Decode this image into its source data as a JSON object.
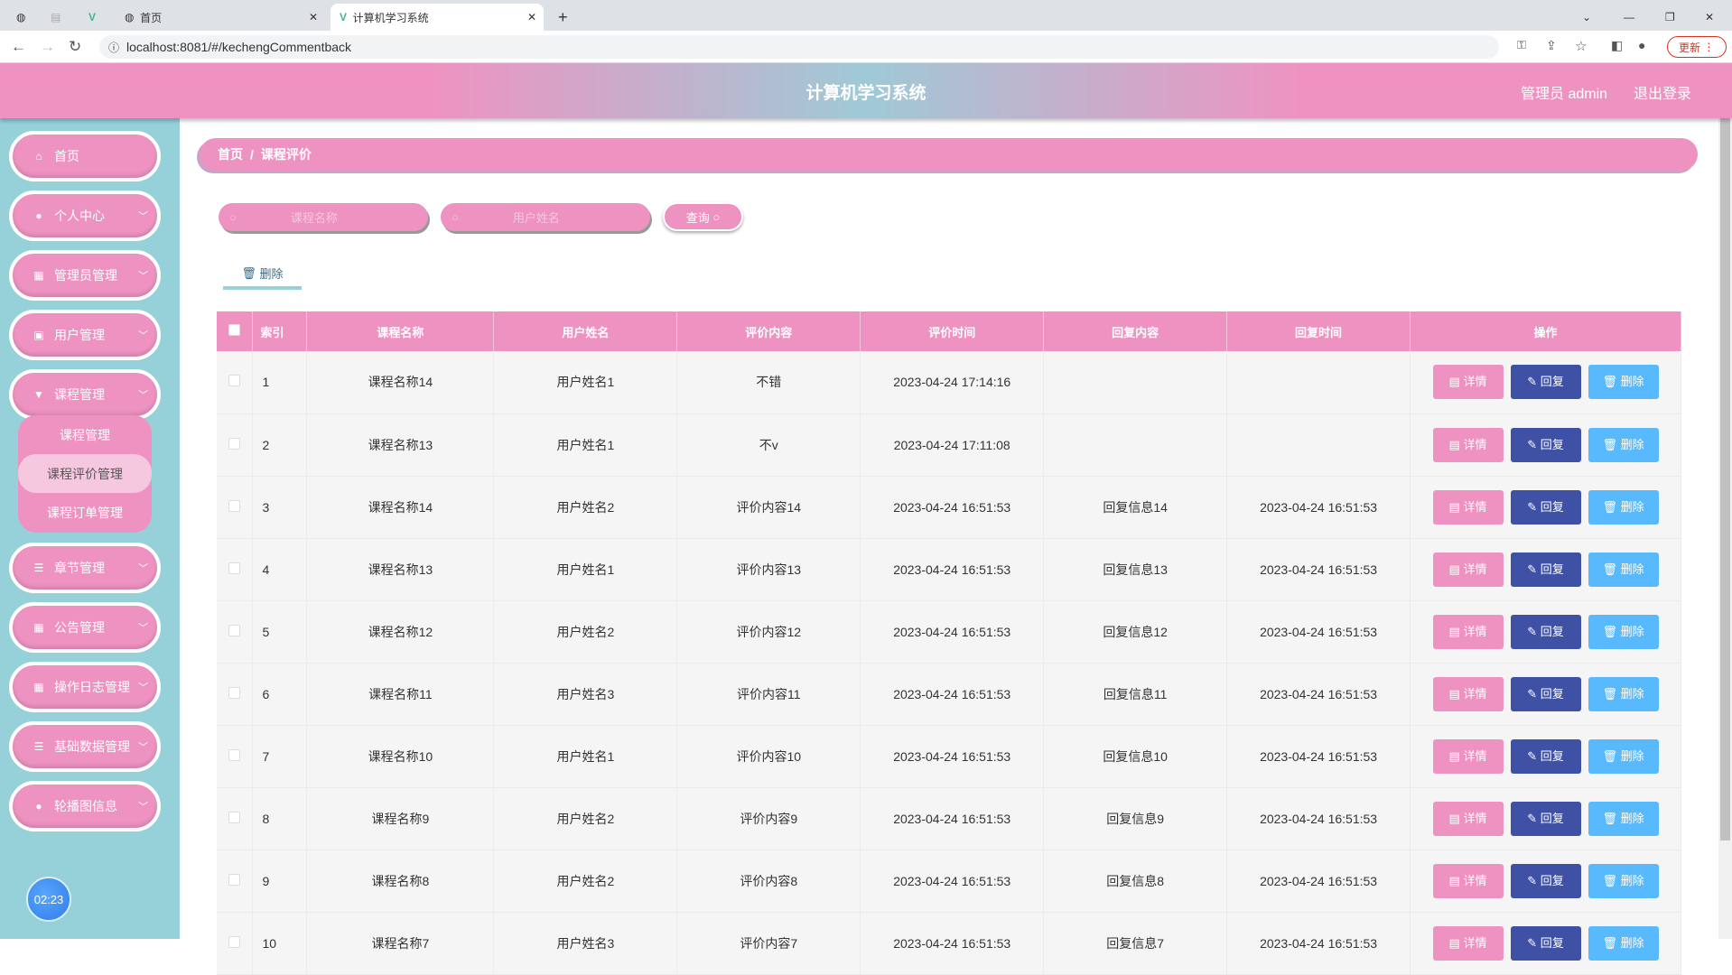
{
  "browser": {
    "tabs": [
      "首页",
      "计算机学习系统"
    ],
    "url": "localhost:8081/#/kechengCommentback",
    "update_label": "更新"
  },
  "header": {
    "title": "计算机学习系统",
    "user": "管理员 admin",
    "logout": "退出登录"
  },
  "sidebar": {
    "items": [
      {
        "label": "首页",
        "icon": "home-icon"
      },
      {
        "label": "个人中心",
        "icon": "user-icon"
      },
      {
        "label": "管理员管理",
        "icon": "grid-icon"
      },
      {
        "label": "用户管理",
        "icon": "clipboard-icon"
      },
      {
        "label": "课程管理",
        "icon": "brush-icon"
      },
      {
        "label": "章节管理",
        "icon": "list-icon"
      },
      {
        "label": "公告管理",
        "icon": "grid9-icon"
      },
      {
        "label": "操作日志管理",
        "icon": "grid-icon"
      },
      {
        "label": "基础数据管理",
        "icon": "list-icon"
      },
      {
        "label": "轮播图信息",
        "icon": "bulb-icon"
      }
    ],
    "submenu": [
      "课程管理",
      "课程评价管理",
      "课程订单管理"
    ],
    "clock": "02:23"
  },
  "breadcrumb": {
    "home": "首页",
    "sep": "/",
    "current": "课程评价"
  },
  "search": {
    "course_placeholder": "课程名称",
    "user_placeholder": "用户姓名",
    "query_label": "查询"
  },
  "toolbar": {
    "delete_label": "删除"
  },
  "table": {
    "headers": [
      "索引",
      "课程名称",
      "用户姓名",
      "评价内容",
      "评价时间",
      "回复内容",
      "回复时间",
      "操作"
    ],
    "actions": {
      "detail": "详情",
      "reply": "回复",
      "delete": "删除"
    },
    "rows": [
      [
        "1",
        "课程名称14",
        "用户姓名1",
        "不错",
        "2023-04-24 17:14:16",
        "",
        ""
      ],
      [
        "2",
        "课程名称13",
        "用户姓名1",
        "不v",
        "2023-04-24 17:11:08",
        "",
        ""
      ],
      [
        "3",
        "课程名称14",
        "用户姓名2",
        "评价内容14",
        "2023-04-24 16:51:53",
        "回复信息14",
        "2023-04-24 16:51:53"
      ],
      [
        "4",
        "课程名称13",
        "用户姓名1",
        "评价内容13",
        "2023-04-24 16:51:53",
        "回复信息13",
        "2023-04-24 16:51:53"
      ],
      [
        "5",
        "课程名称12",
        "用户姓名2",
        "评价内容12",
        "2023-04-24 16:51:53",
        "回复信息12",
        "2023-04-24 16:51:53"
      ],
      [
        "6",
        "课程名称11",
        "用户姓名3",
        "评价内容11",
        "2023-04-24 16:51:53",
        "回复信息11",
        "2023-04-24 16:51:53"
      ],
      [
        "7",
        "课程名称10",
        "用户姓名1",
        "评价内容10",
        "2023-04-24 16:51:53",
        "回复信息10",
        "2023-04-24 16:51:53"
      ],
      [
        "8",
        "课程名称9",
        "用户姓名2",
        "评价内容9",
        "2023-04-24 16:51:53",
        "回复信息9",
        "2023-04-24 16:51:53"
      ],
      [
        "9",
        "课程名称8",
        "用户姓名2",
        "评价内容8",
        "2023-04-24 16:51:53",
        "回复信息8",
        "2023-04-24 16:51:53"
      ],
      [
        "10",
        "课程名称7",
        "用户姓名3",
        "评价内容7",
        "2023-04-24 16:51:53",
        "回复信息7",
        "2023-04-24 16:51:53"
      ]
    ]
  }
}
